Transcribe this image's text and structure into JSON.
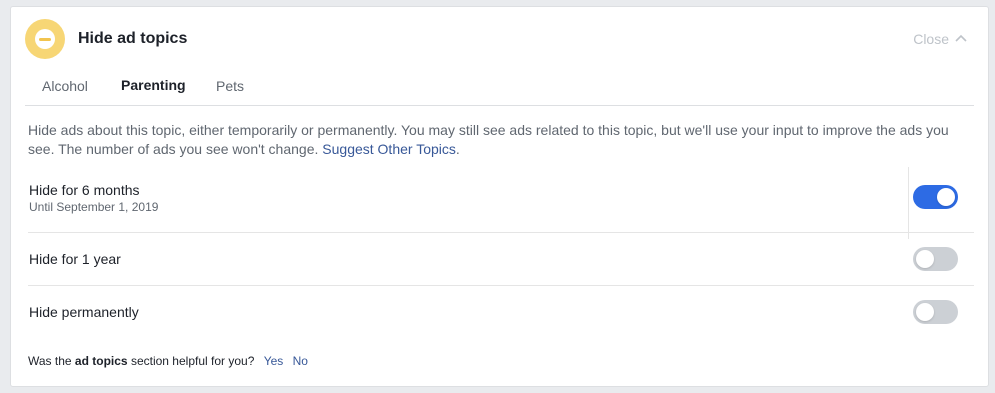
{
  "header": {
    "title": "Hide ad topics",
    "icon": "ad-topic-minus-icon",
    "close_label": "Close",
    "close_icon": "chevron-up-icon"
  },
  "tabs": [
    {
      "label": "Alcohol",
      "active": false
    },
    {
      "label": "Parenting",
      "active": true
    },
    {
      "label": "Pets",
      "active": false
    }
  ],
  "description": {
    "text": "Hide ads about this topic, either temporarily or permanently. You may still see ads related to this topic, but we'll use your input to improve the ads you see. The number of ads you see won't change.",
    "link": "Suggest Other Topics",
    "suffix": "."
  },
  "options": [
    {
      "label": "Hide for 6 months",
      "sublabel": "Until September 1, 2019",
      "enabled": true
    },
    {
      "label": "Hide for 1 year",
      "enabled": false
    },
    {
      "label": "Hide permanently",
      "enabled": false
    }
  ],
  "feedback": {
    "prefix": "Was the",
    "emphasis": "ad topics",
    "suffix": "section helpful for you?",
    "yes": "Yes",
    "no": "No"
  },
  "colors": {
    "accent": "#2d6be4",
    "link": "#385898",
    "icon_bg": "#f7d675"
  }
}
